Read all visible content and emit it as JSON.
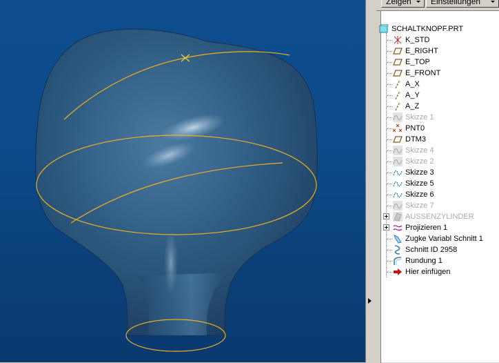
{
  "toolbar": {
    "show_label": "Zeigen",
    "settings_label": "Einstellungen"
  },
  "tree": {
    "root": "SCHALTKNOPF.PRT",
    "items": [
      {
        "label": "K_STD",
        "icon": "csys-icon",
        "dim": false
      },
      {
        "label": "E_RIGHT",
        "icon": "datum-plane-icon",
        "dim": false
      },
      {
        "label": "E_TOP",
        "icon": "datum-plane-icon",
        "dim": false
      },
      {
        "label": "E_FRONT",
        "icon": "datum-plane-icon",
        "dim": false
      },
      {
        "label": "A_X",
        "icon": "datum-axis-icon",
        "dim": false
      },
      {
        "label": "A_Y",
        "icon": "datum-axis-icon",
        "dim": false
      },
      {
        "label": "A_Z",
        "icon": "datum-axis-icon",
        "dim": false
      },
      {
        "label": "Skizze 1",
        "icon": "sketch-icon",
        "dim": true
      },
      {
        "label": "PNT0",
        "icon": "datum-point-icon",
        "dim": false
      },
      {
        "label": "DTM3",
        "icon": "datum-plane-icon",
        "dim": false
      },
      {
        "label": "Skizze 4",
        "icon": "sketch-icon",
        "dim": true
      },
      {
        "label": "Skizze 2",
        "icon": "sketch-icon",
        "dim": true
      },
      {
        "label": "Skizze 3",
        "icon": "sketch-icon",
        "dim": false
      },
      {
        "label": "Skizze 5",
        "icon": "sketch-icon",
        "dim": false
      },
      {
        "label": "Skizze 6",
        "icon": "sketch-icon",
        "dim": false
      },
      {
        "label": "Skizze 7",
        "icon": "sketch-icon",
        "dim": true
      },
      {
        "label": "AUSSENZYLINDER",
        "icon": "surface-icon",
        "dim": true
      },
      {
        "label": "Projizieren 1",
        "icon": "projection-icon",
        "dim": false
      },
      {
        "label": "Zugke Variabl Schnitt 1",
        "icon": "sweep-icon",
        "dim": false
      },
      {
        "label": "Schnitt ID 2958",
        "icon": "cut-icon",
        "dim": false
      },
      {
        "label": "Rundung 1",
        "icon": "round-icon",
        "dim": false
      },
      {
        "label": "Hier einfügen",
        "icon": "insert-arrow-icon",
        "dim": false
      }
    ]
  },
  "colors": {
    "viewport_bg": "#0d4b8a",
    "model_body": "#2f5c80",
    "curve": "#f0b020",
    "insert_arrow": "#d01010"
  }
}
